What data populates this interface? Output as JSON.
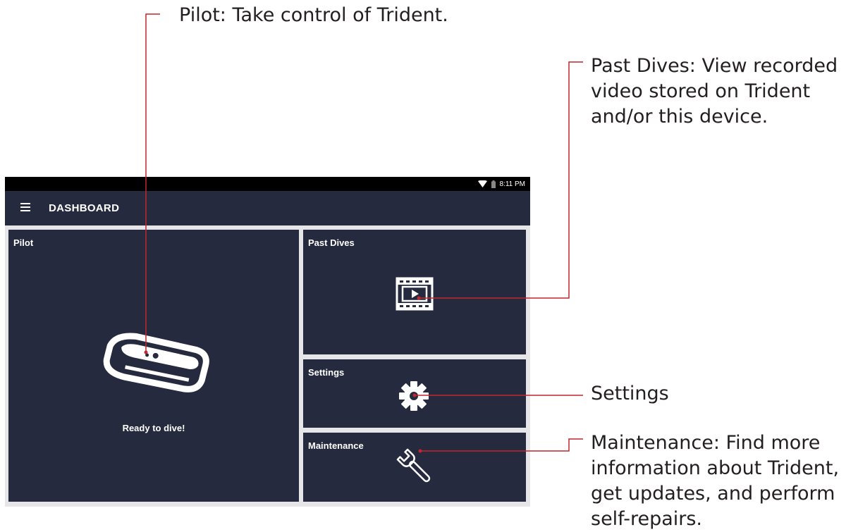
{
  "callouts": {
    "pilot": "Pilot: Take control of Trident.",
    "past_dives": [
      "Past Dives: View recorded",
      "video stored on Trident",
      "and/or this device."
    ],
    "settings": "Settings",
    "maintenance": [
      "Maintenance: Find more",
      "information about Trident,",
      "get updates, and perform",
      "self-repairs."
    ]
  },
  "colors": {
    "callout_line": "#c1272d",
    "tile_bg": "#252a3f",
    "device_bg": "#e6e6e9"
  },
  "status_bar": {
    "time": "8:11 PM",
    "icons": [
      "wifi-icon",
      "battery-icon"
    ]
  },
  "app_bar": {
    "title": "DASHBOARD",
    "menu_icon": "hamburger-menu-icon"
  },
  "tiles": {
    "pilot": {
      "label": "Pilot",
      "status": "Ready to dive!",
      "icon": "trident-drone-icon"
    },
    "past_dives": {
      "label": "Past Dives",
      "icon": "film-play-icon"
    },
    "settings": {
      "label": "Settings",
      "icon": "gear-icon"
    },
    "maintenance": {
      "label": "Maintenance",
      "icon": "wrench-icon"
    }
  }
}
